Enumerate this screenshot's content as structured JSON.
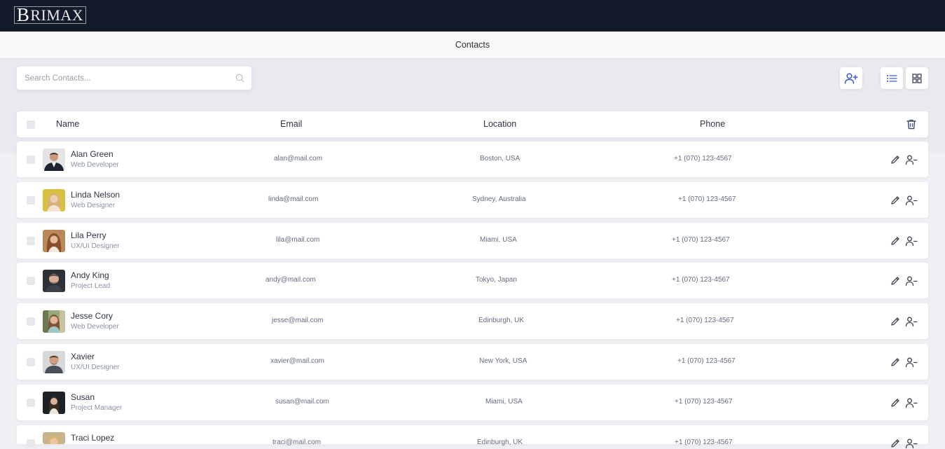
{
  "app": {
    "logo_initial": "B",
    "logo_rest": "RIMAX",
    "page_title": "Contacts"
  },
  "search": {
    "placeholder": "Search Contacts..."
  },
  "toolbar": {
    "icons": [
      "add-contact-icon",
      "list-view-icon",
      "grid-view-icon"
    ],
    "accent": "#3b5bdb"
  },
  "table": {
    "headers": {
      "name": "Name",
      "email": "Email",
      "location": "Location",
      "phone": "Phone"
    },
    "rows": [
      {
        "name": "Alan Green",
        "role": "Web Developer",
        "email": "alan@mail.com",
        "location": "Boston, USA",
        "phone": "+1 (070) 123-4567"
      },
      {
        "name": "Linda Nelson",
        "role": "Web Designer",
        "email": "linda@mail.com",
        "location": "Sydney, Australia",
        "phone": "+1 (070) 123-4567"
      },
      {
        "name": "Lila Perry",
        "role": "UX/UI Designer",
        "email": "lila@mail.com",
        "location": "Miami, USA",
        "phone": "+1 (070) 123-4567"
      },
      {
        "name": "Andy King",
        "role": "Project Lead",
        "email": "andy@mail.com",
        "location": "Tokyo, Japan",
        "phone": "+1 (070) 123-4567"
      },
      {
        "name": "Jesse Cory",
        "role": "Web Developer",
        "email": "jesse@mail.com",
        "location": "Edinburgh, UK",
        "phone": "+1 (070) 123-4567"
      },
      {
        "name": "Xavier",
        "role": "UX/UI Designer",
        "email": "xavier@mail.com",
        "location": "New York, USA",
        "phone": "+1 (070) 123-4567"
      },
      {
        "name": "Susan",
        "role": "Project Manager",
        "email": "susan@mail.com",
        "location": "Miami, USA",
        "phone": "+1 (070) 123-4567"
      },
      {
        "name": "Traci Lopez",
        "role": "",
        "email": "traci@mail.com",
        "location": "Edinburgh, UK",
        "phone": "+1 (070) 123-4567"
      }
    ]
  }
}
